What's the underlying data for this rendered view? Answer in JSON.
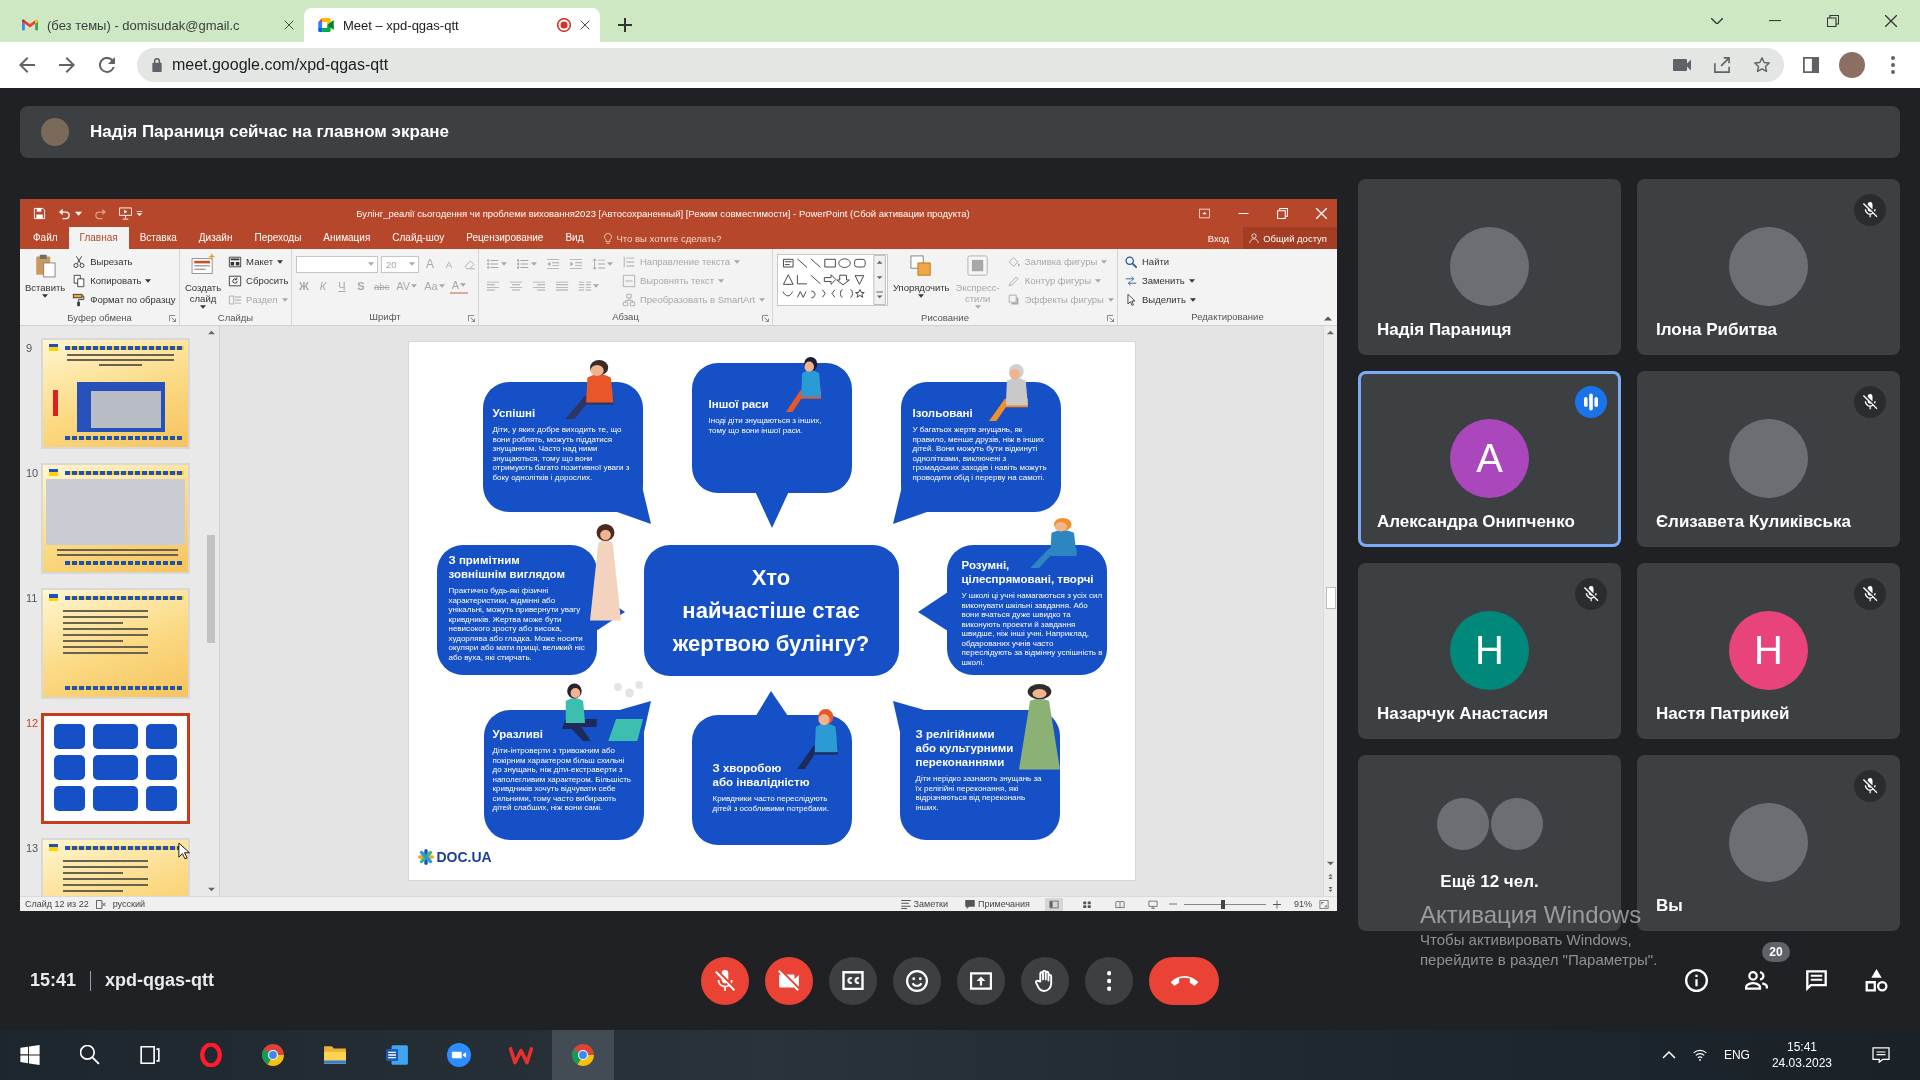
{
  "browser": {
    "tabs": [
      {
        "title": "(без темы) - domisudak@gmail.c",
        "selected": false,
        "recording": false
      },
      {
        "title": "Meet – xpd-qgas-qtt",
        "selected": true,
        "recording": true
      }
    ],
    "url": "meet.google.com/xpd-qgas-qtt"
  },
  "meet": {
    "banner": "Надія Параниця сейчас на главном экране",
    "presentation": {
      "title": "Булінг_реалії сьогодення чи проблеми виховання2023 [Автосохраненный] [Режим совместимости] - PowerPoint (Сбой активации продукта)",
      "tabs": [
        {
          "label": "Файл",
          "selected": false
        },
        {
          "label": "Главная",
          "selected": true
        },
        {
          "label": "Вставка",
          "selected": false
        },
        {
          "label": "Дизайн",
          "selected": false
        },
        {
          "label": "Переходы",
          "selected": false
        },
        {
          "label": "Анимация",
          "selected": false
        },
        {
          "label": "Слайд-шоу",
          "selected": false
        },
        {
          "label": "Рецензирование",
          "selected": false
        },
        {
          "label": "Вид",
          "selected": false
        }
      ],
      "tell_me": "Что вы хотите сделать?",
      "sign_in": "Вход",
      "share": "Общий доступ",
      "ribbon": [
        {
          "label": "Буфер обмена",
          "launcher": true,
          "columns": [
            {
              "kind": "large",
              "label": "Вставить",
              "disabled": false,
              "dropdown": true
            },
            {
              "kind": "stack",
              "items": [
                {
                  "label": "Вырезать",
                  "disabled": false,
                  "dropdown": false
                },
                {
                  "label": "Копировать",
                  "disabled": false,
                  "dropdown": true
                },
                {
                  "label": "Формат по образцу",
                  "disabled": false,
                  "dropdown": false
                }
              ]
            }
          ]
        },
        {
          "label": "Слайды",
          "launcher": false,
          "columns": [
            {
              "kind": "large",
              "label": "Создать слайд",
              "disabled": false,
              "dropdown": true
            },
            {
              "kind": "stack",
              "items": [
                {
                  "label": "Макет",
                  "disabled": false,
                  "dropdown": true
                },
                {
                  "label": "Сбросить",
                  "disabled": false,
                  "dropdown": false
                },
                {
                  "label": "Раздел",
                  "disabled": true,
                  "dropdown": true
                }
              ]
            }
          ]
        },
        {
          "label": "Шрифт",
          "launcher": true,
          "columns": [
            {
              "kind": "rows",
              "rows": [
                {
                  "items": [
                    {
                      "kind": "field",
                      "disabled": true
                    },
                    {
                      "kind": "field",
                      "value": "20",
                      "disabled": true
                    },
                    {
                      "kind": "glyph",
                      "label": "A",
                      "disabled": true,
                      "dropdown": false
                    },
                    {
                      "kind": "glyph",
                      "label": "A",
                      "disabled": true,
                      "dropdown": false
                    },
                    {
                      "kind": "icon",
                      "disabled": true,
                      "dropdown": false
                    }
                  ]
                },
                {
                  "items": [
                    {
                      "kind": "glyph",
                      "label": "Ж",
                      "disabled": true,
                      "dropdown": false
                    },
                    {
                      "kind": "glyph",
                      "label": "К",
                      "disabled": true,
                      "dropdown": false
                    },
                    {
                      "kind": "glyph",
                      "label": "Ч",
                      "disabled": true,
                      "dropdown": false
                    },
                    {
                      "kind": "glyph",
                      "label": "S",
                      "disabled": true,
                      "dropdown": false
                    },
                    {
                      "kind": "glyph",
                      "label": "abc",
                      "disabled": true,
                      "dropdown": false
                    },
                    {
                      "kind": "glyph",
                      "label": "AV",
                      "disabled": true,
                      "dropdown": true
                    },
                    {
                      "kind": "glyph",
                      "label": "Aa",
                      "disabled": true,
                      "dropdown": true
                    },
                    {
                      "kind": "glyph",
                      "label": "A",
                      "disabled": true,
                      "dropdown": true
                    }
                  ]
                }
              ]
            }
          ]
        },
        {
          "label": "Абзац",
          "launcher": true,
          "columns": [
            {
              "kind": "rows",
              "rows": [
                {
                  "items": [
                    {
                      "kind": "icon",
                      "disabled": true,
                      "dropdown": true
                    },
                    {
                      "kind": "icon",
                      "disabled": true,
                      "dropdown": true
                    },
                    {
                      "kind": "icon",
                      "disabled": true,
                      "dropdown": false
                    },
                    {
                      "kind": "icon",
                      "disabled": true,
                      "dropdown": false
                    },
                    {
                      "kind": "icon",
                      "disabled": true,
                      "dropdown": true
                    }
                  ]
                },
                {
                  "items": [
                    {
                      "kind": "icon",
                      "disabled": true,
                      "dropdown": false
                    },
                    {
                      "kind": "icon",
                      "disabled": true,
                      "dropdown": false
                    },
                    {
                      "kind": "icon",
                      "disabled": true,
                      "dropdown": false
                    },
                    {
                      "kind": "icon",
                      "disabled": true,
                      "dropdown": false
                    },
                    {
                      "kind": "icon",
                      "disabled": true,
                      "dropdown": true
                    }
                  ]
                }
              ]
            },
            {
              "kind": "stack",
              "items": [
                {
                  "label": "Направление текста",
                  "disabled": true,
                  "dropdown": true
                },
                {
                  "label": "Выровнять текст",
                  "disabled": true,
                  "dropdown": true
                },
                {
                  "label": "Преобразовать в SmartArt",
                  "disabled": true,
                  "dropdown": true
                }
              ]
            }
          ]
        },
        {
          "label": "Рисование",
          "launcher": true,
          "columns": [
            {
              "kind": "gallery"
            },
            {
              "kind": "large",
              "label": "Упорядочить",
              "disabled": false,
              "dropdown": true
            },
            {
              "kind": "large",
              "label": "Экспресс-стили",
              "disabled": true,
              "dropdown": true
            },
            {
              "kind": "stack",
              "items": [
                {
                  "label": "Заливка фигуры",
                  "disabled": true,
                  "dropdown": true
                },
                {
                  "label": "Контур фигуры",
                  "disabled": true,
                  "dropdown": true
                },
                {
                  "label": "Эффекты фигуры",
                  "disabled": true,
                  "dropdown": true
                }
              ]
            }
          ]
        },
        {
          "label": "Редактирование",
          "launcher": false,
          "columns": [
            {
              "kind": "stack",
              "items": [
                {
                  "label": "Найти",
                  "disabled": false,
                  "dropdown": false
                },
                {
                  "label": "Заменить",
                  "disabled": false,
                  "dropdown": true
                },
                {
                  "label": "Выделить",
                  "disabled": false,
                  "dropdown": true
                }
              ]
            }
          ]
        }
      ],
      "thumbnails": [
        {
          "number": "9",
          "kind": "framed",
          "selected": false
        },
        {
          "number": "10",
          "kind": "photo",
          "selected": false
        },
        {
          "number": "11",
          "kind": "text",
          "selected": false
        },
        {
          "number": "12",
          "kind": "infographic",
          "selected": true
        },
        {
          "number": "13",
          "kind": "text",
          "selected": false
        }
      ],
      "slide": {
        "question": "Хто\nнайчастіше стає\nжертвою булінгу?",
        "bubbles": [
          {
            "title": "Успішні",
            "text": "Діти, у яких добре виходить те, що вони роблять, можуть піддатися знущанням. Часто над ними знущаються, тому що вони отримують багато позитивної уваги з боку однолітків і дорослих."
          },
          {
            "title": "Іншої раси",
            "text": "Іноді діти знущаються з інших, тому що вони іншої раси."
          },
          {
            "title": "Ізольовані",
            "text": "У багатьох жертв знущань, як правило, менше друзів, ніж в інших дітей. Вони можуть бути відкинуті однолітками, виключені з громадських заходів і навіть можуть проводити обід і перерву на самоті."
          },
          {
            "title": "З примітним\nзовнішнім виглядом",
            "text": "Практично будь-які фізичні характеристики, відмінні або унікальні, можуть привернути увагу кривдників. Жертва може бути невисокого зросту або висока, худорлява або гладка. Може носити окуляри або мати прищі, великий ніс або вуха, які стирчать."
          },
          {
            "title": "Розумні,\nцілеспрямовані, творчі",
            "text": "У школі ці учні намагаються з усіх сил виконувати шкільні завдання. Або вони вчаться дуже швидко та виконують проекти й завдання швидше, ніж інші учні. Наприклад, обдарованих учнів часто переслідують за відмінну успішність в школі."
          },
          {
            "title": "Уразливі",
            "text": "Діти-інтроверти з тривожним або покірним характером більш схильні до знущань, ніж діти-екстраверти з наполегливим характером. Більшість кривдників хочуть відчувати себе сильними, тому часто вибирають дітей слабших, ніж вони самі."
          },
          {
            "title": "З хворобою\nабо інвалідністю",
            "text": "Кривдники часто переслідують дітей з особливими потребами."
          },
          {
            "title": "З релігійними\nабо культурними\nпереконаннями",
            "text": "Діти нерідко зазнають знущань за їх релігійні переконання, які відрізняються від переконань інших."
          }
        ],
        "logo": "DOC.UA"
      },
      "status": {
        "slide": "Слайд 12 из 22",
        "language": "русский",
        "notes": "Заметки",
        "comments": "Примечания",
        "views": [
          {
            "selected": true
          },
          {
            "selected": false
          },
          {
            "selected": false
          },
          {
            "selected": false
          }
        ],
        "zoom_slider": {
          "level": 0.47
        },
        "zoom": "91%"
      }
    },
    "participants": [
      {
        "kind": "photo",
        "name": "Надія Параниця",
        "muted": false,
        "speaking": false
      },
      {
        "kind": "photo",
        "name": "Ілона Рибитва",
        "muted": true,
        "speaking": false
      },
      {
        "kind": "letter",
        "name": "Александра Онипченко",
        "initial": "А",
        "color": "#ab47bc",
        "muted": false,
        "speaking": true
      },
      {
        "kind": "photo",
        "name": "Єлизавета Куликівська",
        "muted": true,
        "speaking": false
      },
      {
        "kind": "letter",
        "name": "Назарчук Анастасия",
        "initial": "Н",
        "color": "#00897b",
        "muted": true,
        "speaking": false
      },
      {
        "kind": "letter",
        "name": "Настя Патрикей",
        "initial": "Н",
        "color": "#e8437a",
        "muted": true,
        "speaking": false
      },
      {
        "kind": "group",
        "name": "Ещё 12 чел.",
        "muted": false,
        "speaking": false
      },
      {
        "kind": "photo",
        "name": "Вы",
        "muted": true,
        "speaking": false
      }
    ],
    "time": "15:41",
    "meeting_code": "xpd-qgas-qtt",
    "controls": [
      {
        "kind": "microphone",
        "on": false
      },
      {
        "kind": "camera",
        "on": false
      },
      {
        "kind": "captions",
        "on": false
      },
      {
        "kind": "reactions"
      },
      {
        "kind": "present"
      },
      {
        "kind": "hand"
      },
      {
        "kind": "more"
      },
      {
        "kind": "leave"
      }
    ],
    "side_buttons": [
      {
        "kind": "info"
      },
      {
        "kind": "people",
        "badge": "20"
      },
      {
        "kind": "chat"
      },
      {
        "kind": "activities"
      }
    ]
  },
  "windows_activation": {
    "title": "Активация Windows",
    "text": "Чтобы активировать Windows, перейдите в раздел \"Параметры\"."
  },
  "taskbar": {
    "apps": [
      {
        "active": false
      },
      {
        "active": false
      },
      {
        "active": false
      },
      {
        "active": false
      },
      {
        "active": false
      },
      {
        "active": false
      },
      {
        "active": true
      }
    ],
    "language": "ENG",
    "time": "15:41",
    "date": "24.03.2023"
  }
}
